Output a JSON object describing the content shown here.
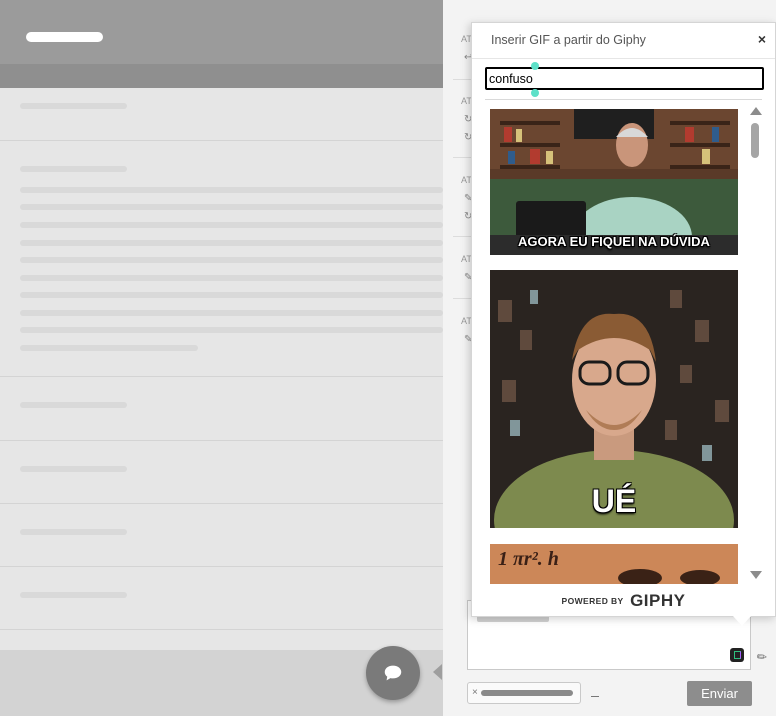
{
  "giphy_popover": {
    "title": "Inserir GIF a partir do Giphy",
    "close_label": "×",
    "search_value": "confuso",
    "results": [
      {
        "caption": "AGORA EU FIQUEI NA DÚVIDA"
      },
      {
        "caption": "UÉ"
      },
      {
        "caption": "1 πr². h"
      }
    ],
    "powered_by": "POWERED BY",
    "brand": "GIPHY"
  },
  "activity": {
    "labels": [
      "AT",
      "AT",
      "AT",
      "AT",
      "AT"
    ]
  },
  "composer": {
    "cc_remove": "×",
    "send_label": "Enviar"
  },
  "colors": {
    "send_button": "#8d8d8d",
    "header": "#9b9b9b",
    "giphy_green": "#2ec27e",
    "giphy_purple": "#a65dfc"
  }
}
